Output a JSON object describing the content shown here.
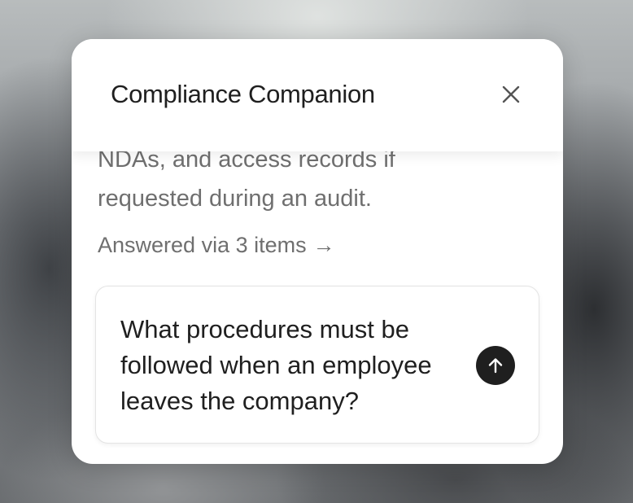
{
  "modal": {
    "title": "Compliance Companion",
    "close_icon": "close-icon"
  },
  "answer": {
    "lines": [
      "NDAs, and access records if",
      "requested during an audit."
    ]
  },
  "sources": {
    "label": "Answered via 3 items",
    "arrow": "→",
    "arrow_icon": "arrow-right-icon"
  },
  "question": {
    "lines": [
      "What procedures must be",
      "followed when an employee",
      "leaves the company?"
    ],
    "send_icon": "arrow-up-icon"
  },
  "colors": {
    "send_button": "#1f1f1f",
    "muted_text": "#6f6f6f",
    "primary_text": "#1f1f1f"
  }
}
